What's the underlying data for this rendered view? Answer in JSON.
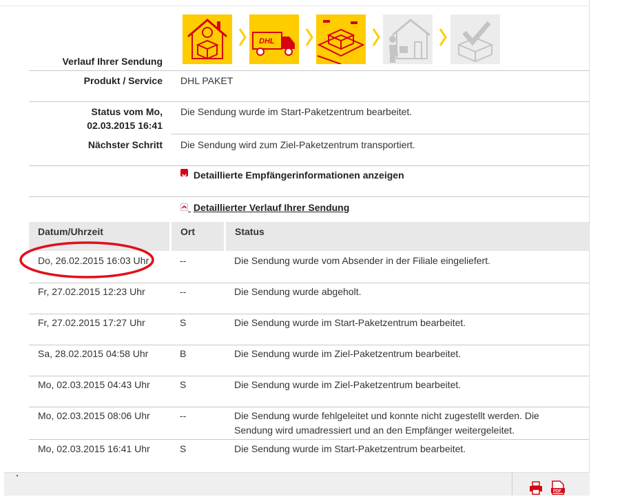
{
  "summary": {
    "history_label": "Verlauf Ihrer Sendung",
    "product_label": "Produkt / Service",
    "product_value": "DHL PAKET",
    "status_label_line1": "Status vom Mo,",
    "status_label_line2": "02.03.2015 16:41",
    "status_value": "Die Sendung wurde im Start-Paketzentrum bearbeitet.",
    "next_label": "Nächster Schritt",
    "next_value": "Die Sendung wird zum Ziel-Paketzentrum transportiert."
  },
  "progress_steps": [
    {
      "icon": "house-parcel-icon",
      "active": true
    },
    {
      "icon": "delivery-truck-icon",
      "active": true
    },
    {
      "icon": "parcel-center-icon",
      "active": true
    },
    {
      "icon": "courier-delivery-icon",
      "active": false
    },
    {
      "icon": "delivered-check-icon",
      "active": false
    }
  ],
  "toggles": {
    "recipient_info": "Detaillierte Empfängerinformationen anzeigen",
    "detailed_history": "Detaillierter Verlauf Ihrer Sendung"
  },
  "table": {
    "headers": {
      "datetime": "Datum/Uhrzeit",
      "location": "Ort",
      "status": "Status"
    },
    "rows": [
      {
        "datetime": "Do, 26.02.2015 16:03 Uhr",
        "location": "--",
        "status": "Die Sendung wurde vom Absender in der Filiale eingeliefert."
      },
      {
        "datetime": "Fr, 27.02.2015 12:23 Uhr",
        "location": "--",
        "status": "Die Sendung wurde abgeholt."
      },
      {
        "datetime": "Fr, 27.02.2015 17:27 Uhr",
        "location": "S",
        "status": "Die Sendung wurde im Start-Paketzentrum bearbeitet."
      },
      {
        "datetime": "Sa, 28.02.2015 04:58 Uhr",
        "location": "B",
        "status": "Die Sendung wurde im Ziel-Paketzentrum bearbeitet."
      },
      {
        "datetime": "Mo, 02.03.2015 04:43 Uhr",
        "location": "S",
        "status": "Die Sendung wurde im Ziel-Paketzentrum bearbeitet."
      },
      {
        "datetime": "Mo, 02.03.2015 08:06 Uhr",
        "location": "--",
        "status_line1": "Die Sendung wurde fehlgeleitet und konnte nicht zugestellt werden. Die",
        "status_line2": "Sendung wird umadressiert und an den Empfänger weitergeleitet."
      },
      {
        "datetime": "Mo, 02.03.2015 16:41 Uhr",
        "location": "S",
        "status": "Die Sendung wurde im Start-Paketzentrum bearbeitet."
      }
    ]
  },
  "colors": {
    "dhl_yellow": "#ffcc00",
    "dhl_red": "#d40511",
    "annotation_red": "#e0101a"
  },
  "footer_icons": [
    "print-icon",
    "pdf-icon"
  ]
}
